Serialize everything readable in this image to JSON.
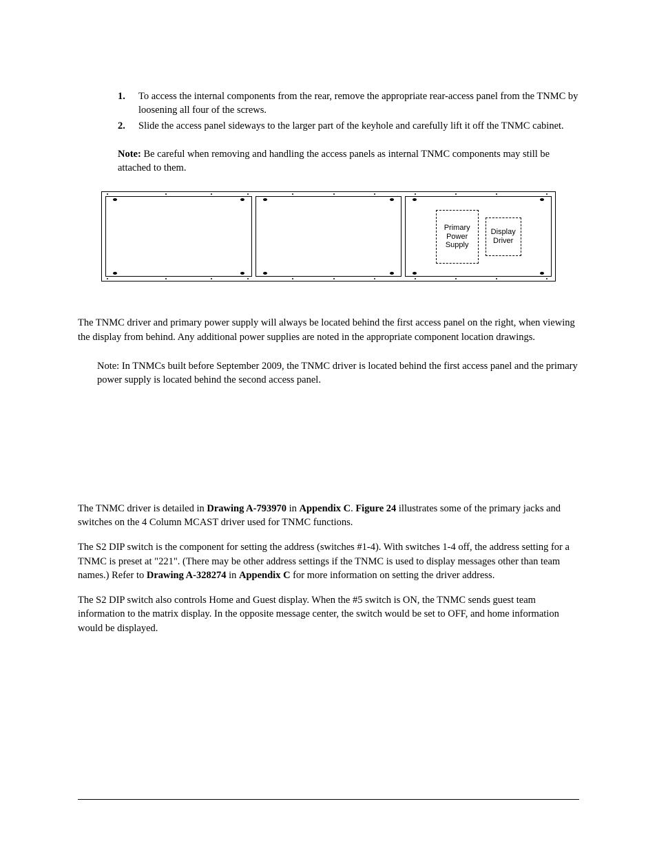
{
  "list": {
    "items": [
      {
        "num": "1.",
        "text": "To access the internal components from the rear, remove the appropriate rear-access panel from the TNMC by loosening all four of the screws."
      },
      {
        "num": "2.",
        "text": "Slide the access panel sideways to the larger part of the keyhole and carefully lift it off the TNMC cabinet."
      }
    ]
  },
  "note1": {
    "label": "Note:",
    "text": " Be careful when removing and handling the access panels as internal TNMC components may still be attached to them."
  },
  "figure": {
    "primary_label": "Primary Power Supply",
    "driver_label": "Display Driver"
  },
  "para1": "The TNMC driver and primary power supply will always be located behind the first access panel on the right, when viewing the display from behind. Any additional power supplies are noted in the appropriate component location drawings.",
  "note2": {
    "label": "Note:",
    "text": " In TNMCs built before September 2009, the TNMC driver is located behind the first access panel and the primary power supply is located behind the second access panel."
  },
  "para2": {
    "a": "The TNMC driver is detailed in ",
    "b": "Drawing A-793970",
    "c": " in ",
    "d": "Appendix C",
    "e": ". ",
    "f": "Figure 24",
    "g": " illustrates some of the primary jacks and switches on the 4 Column MCAST driver used for TNMC functions."
  },
  "para3": {
    "a": "The S2 DIP switch is the component for setting the address (switches #1-4). With switches 1-4 off, the address setting for a TNMC is preset at \"221\". (There may be other address settings if the TNMC is used to display messages other than team names.) Refer to ",
    "b": "Drawing A-328274",
    "c": " in ",
    "d": "Appendix C",
    "e": " for more information on setting the driver address."
  },
  "para4": "The S2 DIP switch also controls Home and Guest display. When the #5 switch is ON, the TNMC sends guest team information to the matrix display. In the opposite message center, the switch would be set to OFF, and home information would be displayed."
}
